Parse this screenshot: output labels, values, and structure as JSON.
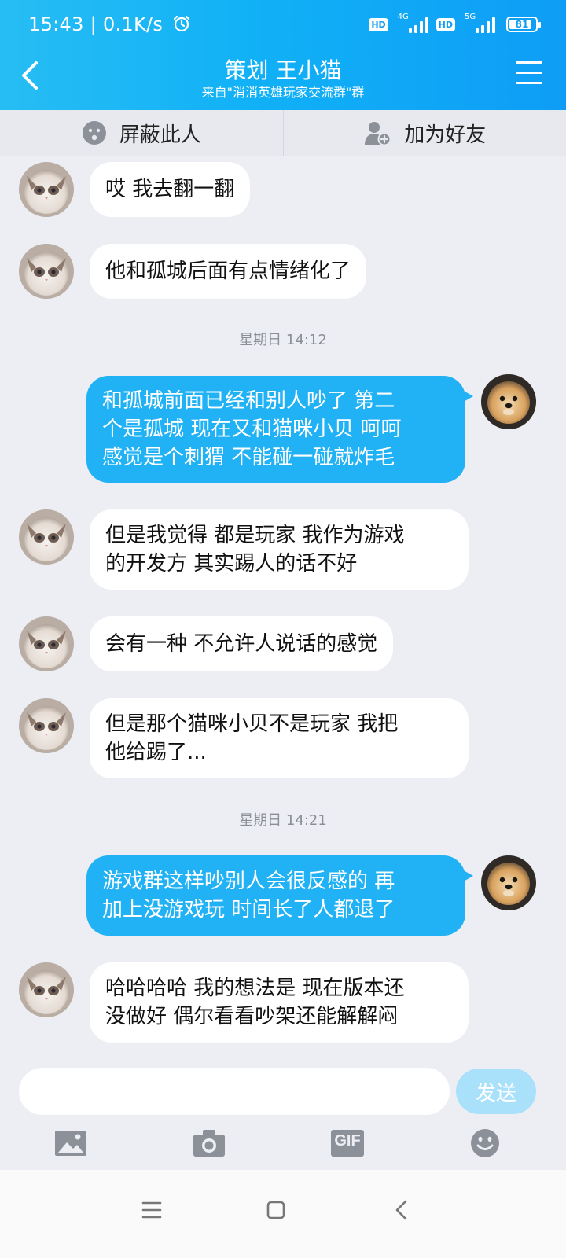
{
  "status_bar": {
    "time": "15:43",
    "speed": "0.1K/s",
    "alarm_icon": "alarm-icon",
    "sim1": {
      "hd": "HD",
      "net": "4G"
    },
    "sim2": {
      "hd": "HD",
      "net": "5G"
    },
    "battery": "81"
  },
  "header": {
    "title": "策划 王小猫",
    "subtitle": "来自\"消消英雄玩家交流群\"群",
    "back_icon": "chevron-left-icon",
    "menu_icon": "hamburger-menu-icon"
  },
  "actions": [
    {
      "label": "屏蔽此人",
      "icon": "block-face-icon"
    },
    {
      "label": "加为好友",
      "icon": "add-friend-icon"
    }
  ],
  "messages": [
    {
      "side": "in",
      "text": "哎 我去翻一翻"
    },
    {
      "side": "in",
      "text": "他和孤城后面有点情绪化了"
    },
    {
      "type": "time",
      "text": "星期日 14:12"
    },
    {
      "side": "out",
      "text": "和孤城前面已经和别人吵了 第二\n个是孤城  现在又和猫咪小贝 呵呵\n感觉是个刺猬 不能碰一碰就炸毛"
    },
    {
      "side": "in",
      "text": "但是我觉得 都是玩家 我作为游戏\n的开发方 其实踢人的话不好"
    },
    {
      "side": "in",
      "text": "会有一种 不允许人说话的感觉"
    },
    {
      "side": "in",
      "text": "但是那个猫咪小贝不是玩家 我把\n他给踢了..."
    },
    {
      "type": "time",
      "text": "星期日 14:21"
    },
    {
      "side": "out",
      "text": "游戏群这样吵别人会很反感的 再\n加上没游戏玩 时间长了人都退了"
    },
    {
      "side": "in",
      "text": "哈哈哈哈 我的想法是 现在版本还\n没做好 偶尔看看吵架还能解解闷"
    }
  ],
  "input": {
    "placeholder": "",
    "value": ""
  },
  "send_label": "发送",
  "toolbar": [
    {
      "icon": "image-icon"
    },
    {
      "icon": "camera-icon"
    },
    {
      "icon": "gif-icon",
      "label": "GIF"
    },
    {
      "icon": "emoji-icon"
    }
  ],
  "nav": [
    {
      "icon": "menu-nav-icon"
    },
    {
      "icon": "home-nav-icon"
    },
    {
      "icon": "back-nav-icon"
    }
  ],
  "colors": {
    "accent": "#11B1F6",
    "outgoing_bubble": "#21B2F5",
    "incoming_bubble": "#FFFFFF",
    "background": "#ECEEF3",
    "send_disabled": "#A9E1FB"
  }
}
